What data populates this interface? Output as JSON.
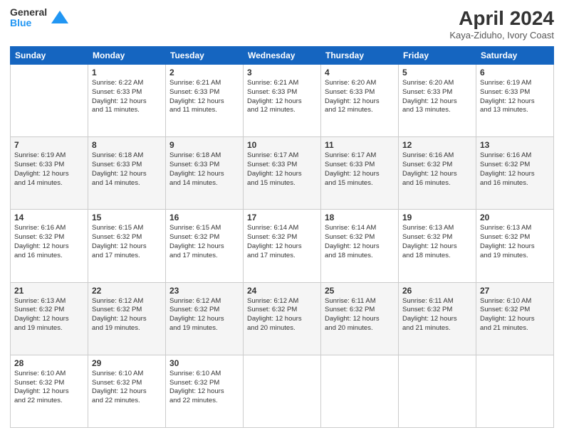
{
  "header": {
    "logo": {
      "general": "General",
      "blue": "Blue"
    },
    "title": "April 2024",
    "subtitle": "Kaya-Ziduho, Ivory Coast"
  },
  "weekdays": [
    "Sunday",
    "Monday",
    "Tuesday",
    "Wednesday",
    "Thursday",
    "Friday",
    "Saturday"
  ],
  "weeks": [
    [
      {
        "day": "",
        "info": ""
      },
      {
        "day": "1",
        "info": "Sunrise: 6:22 AM\nSunset: 6:33 PM\nDaylight: 12 hours\nand 11 minutes."
      },
      {
        "day": "2",
        "info": "Sunrise: 6:21 AM\nSunset: 6:33 PM\nDaylight: 12 hours\nand 11 minutes."
      },
      {
        "day": "3",
        "info": "Sunrise: 6:21 AM\nSunset: 6:33 PM\nDaylight: 12 hours\nand 12 minutes."
      },
      {
        "day": "4",
        "info": "Sunrise: 6:20 AM\nSunset: 6:33 PM\nDaylight: 12 hours\nand 12 minutes."
      },
      {
        "day": "5",
        "info": "Sunrise: 6:20 AM\nSunset: 6:33 PM\nDaylight: 12 hours\nand 13 minutes."
      },
      {
        "day": "6",
        "info": "Sunrise: 6:19 AM\nSunset: 6:33 PM\nDaylight: 12 hours\nand 13 minutes."
      }
    ],
    [
      {
        "day": "7",
        "info": "Sunrise: 6:19 AM\nSunset: 6:33 PM\nDaylight: 12 hours\nand 14 minutes."
      },
      {
        "day": "8",
        "info": "Sunrise: 6:18 AM\nSunset: 6:33 PM\nDaylight: 12 hours\nand 14 minutes."
      },
      {
        "day": "9",
        "info": "Sunrise: 6:18 AM\nSunset: 6:33 PM\nDaylight: 12 hours\nand 14 minutes."
      },
      {
        "day": "10",
        "info": "Sunrise: 6:17 AM\nSunset: 6:33 PM\nDaylight: 12 hours\nand 15 minutes."
      },
      {
        "day": "11",
        "info": "Sunrise: 6:17 AM\nSunset: 6:33 PM\nDaylight: 12 hours\nand 15 minutes."
      },
      {
        "day": "12",
        "info": "Sunrise: 6:16 AM\nSunset: 6:32 PM\nDaylight: 12 hours\nand 16 minutes."
      },
      {
        "day": "13",
        "info": "Sunrise: 6:16 AM\nSunset: 6:32 PM\nDaylight: 12 hours\nand 16 minutes."
      }
    ],
    [
      {
        "day": "14",
        "info": "Sunrise: 6:16 AM\nSunset: 6:32 PM\nDaylight: 12 hours\nand 16 minutes."
      },
      {
        "day": "15",
        "info": "Sunrise: 6:15 AM\nSunset: 6:32 PM\nDaylight: 12 hours\nand 17 minutes."
      },
      {
        "day": "16",
        "info": "Sunrise: 6:15 AM\nSunset: 6:32 PM\nDaylight: 12 hours\nand 17 minutes."
      },
      {
        "day": "17",
        "info": "Sunrise: 6:14 AM\nSunset: 6:32 PM\nDaylight: 12 hours\nand 17 minutes."
      },
      {
        "day": "18",
        "info": "Sunrise: 6:14 AM\nSunset: 6:32 PM\nDaylight: 12 hours\nand 18 minutes."
      },
      {
        "day": "19",
        "info": "Sunrise: 6:13 AM\nSunset: 6:32 PM\nDaylight: 12 hours\nand 18 minutes."
      },
      {
        "day": "20",
        "info": "Sunrise: 6:13 AM\nSunset: 6:32 PM\nDaylight: 12 hours\nand 19 minutes."
      }
    ],
    [
      {
        "day": "21",
        "info": "Sunrise: 6:13 AM\nSunset: 6:32 PM\nDaylight: 12 hours\nand 19 minutes."
      },
      {
        "day": "22",
        "info": "Sunrise: 6:12 AM\nSunset: 6:32 PM\nDaylight: 12 hours\nand 19 minutes."
      },
      {
        "day": "23",
        "info": "Sunrise: 6:12 AM\nSunset: 6:32 PM\nDaylight: 12 hours\nand 19 minutes."
      },
      {
        "day": "24",
        "info": "Sunrise: 6:12 AM\nSunset: 6:32 PM\nDaylight: 12 hours\nand 20 minutes."
      },
      {
        "day": "25",
        "info": "Sunrise: 6:11 AM\nSunset: 6:32 PM\nDaylight: 12 hours\nand 20 minutes."
      },
      {
        "day": "26",
        "info": "Sunrise: 6:11 AM\nSunset: 6:32 PM\nDaylight: 12 hours\nand 21 minutes."
      },
      {
        "day": "27",
        "info": "Sunrise: 6:10 AM\nSunset: 6:32 PM\nDaylight: 12 hours\nand 21 minutes."
      }
    ],
    [
      {
        "day": "28",
        "info": "Sunrise: 6:10 AM\nSunset: 6:32 PM\nDaylight: 12 hours\nand 22 minutes."
      },
      {
        "day": "29",
        "info": "Sunrise: 6:10 AM\nSunset: 6:32 PM\nDaylight: 12 hours\nand 22 minutes."
      },
      {
        "day": "30",
        "info": "Sunrise: 6:10 AM\nSunset: 6:32 PM\nDaylight: 12 hours\nand 22 minutes."
      },
      {
        "day": "",
        "info": ""
      },
      {
        "day": "",
        "info": ""
      },
      {
        "day": "",
        "info": ""
      },
      {
        "day": "",
        "info": ""
      }
    ]
  ]
}
